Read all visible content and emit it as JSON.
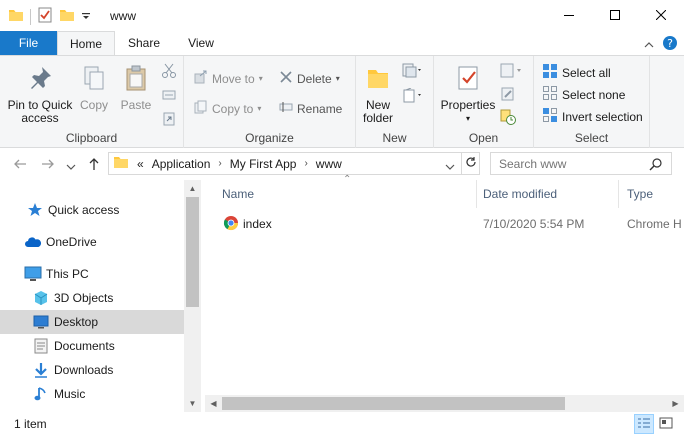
{
  "window": {
    "title": "www",
    "controls": {
      "minimize": "minimize-icon",
      "maximize": "maximize-icon",
      "close": "close-icon"
    }
  },
  "ribbon_tabs": [
    {
      "label": "File"
    },
    {
      "label": "Home"
    },
    {
      "label": "Share"
    },
    {
      "label": "View"
    }
  ],
  "ribbon": {
    "clipboard": {
      "group_label": "Clipboard",
      "pin_label": "Pin to Quick access",
      "copy_label": "Copy",
      "paste_label": "Paste"
    },
    "organize": {
      "group_label": "Organize",
      "move_to": "Move to",
      "copy_to": "Copy to",
      "delete": "Delete",
      "rename": "Rename"
    },
    "new": {
      "group_label": "New",
      "new_folder": "New folder"
    },
    "open": {
      "group_label": "Open",
      "properties": "Properties"
    },
    "select": {
      "group_label": "Select",
      "select_all": "Select all",
      "select_none": "Select none",
      "invert_selection": "Invert selection"
    }
  },
  "address": {
    "overflow": "«",
    "crumbs": [
      "Application",
      "My First App",
      "www"
    ]
  },
  "search": {
    "placeholder": "Search www"
  },
  "nav_pane": {
    "items": [
      {
        "label": "Quick access",
        "icon": "star-icon"
      },
      {
        "label": "OneDrive",
        "icon": "cloud-icon"
      },
      {
        "label": "This PC",
        "icon": "computer-icon"
      },
      {
        "label": "3D Objects",
        "icon": "cube-icon"
      },
      {
        "label": "Desktop",
        "icon": "desktop-icon",
        "selected": true
      },
      {
        "label": "Documents",
        "icon": "document-icon"
      },
      {
        "label": "Downloads",
        "icon": "download-icon"
      },
      {
        "label": "Music",
        "icon": "music-icon"
      }
    ]
  },
  "file_list": {
    "columns": [
      "Name",
      "Date modified",
      "Type"
    ],
    "rows": [
      {
        "name": "index",
        "date_modified": "7/10/2020 5:54 PM",
        "type": "Chrome H",
        "icon": "chrome-icon"
      }
    ]
  },
  "status_bar": {
    "item_count": "1 item"
  },
  "colors": {
    "accent": "#1979ca",
    "selected_bg": "#d9d9d9",
    "folder": "#ffc83d"
  }
}
